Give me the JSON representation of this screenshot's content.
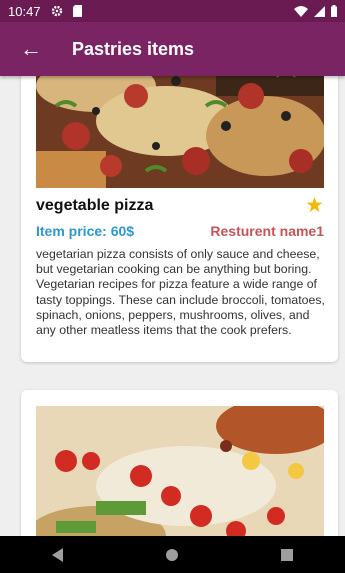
{
  "status_bar": {
    "time": "10:47"
  },
  "app_bar": {
    "title": "Pastries items"
  },
  "items": [
    {
      "name": "vegetable pizza",
      "price": "Item price: 60$",
      "restaurant": "Resturent name1",
      "description": "vegetarian pizza consists of only sauce and cheese, but vegetarian cooking can be anything but boring. Vegetarian recipes for pizza feature a wide range of tasty toppings. These can include broccoli, tomatoes, spinach, onions, peppers, mushrooms, olives, and any other meatless items that the cook prefers.",
      "favorite": true
    }
  ],
  "colors": {
    "primary": "#7b2464",
    "status": "#6a1b52",
    "price": "#2f97cf",
    "restaurant": "#c4545a",
    "star": "#f5b800"
  },
  "icons": [
    "settings-icon",
    "sd-card-icon",
    "wifi-icon",
    "signal-icon",
    "battery-icon",
    "back-arrow-icon",
    "star-icon",
    "nav-back-icon",
    "nav-home-icon",
    "nav-recents-icon"
  ]
}
